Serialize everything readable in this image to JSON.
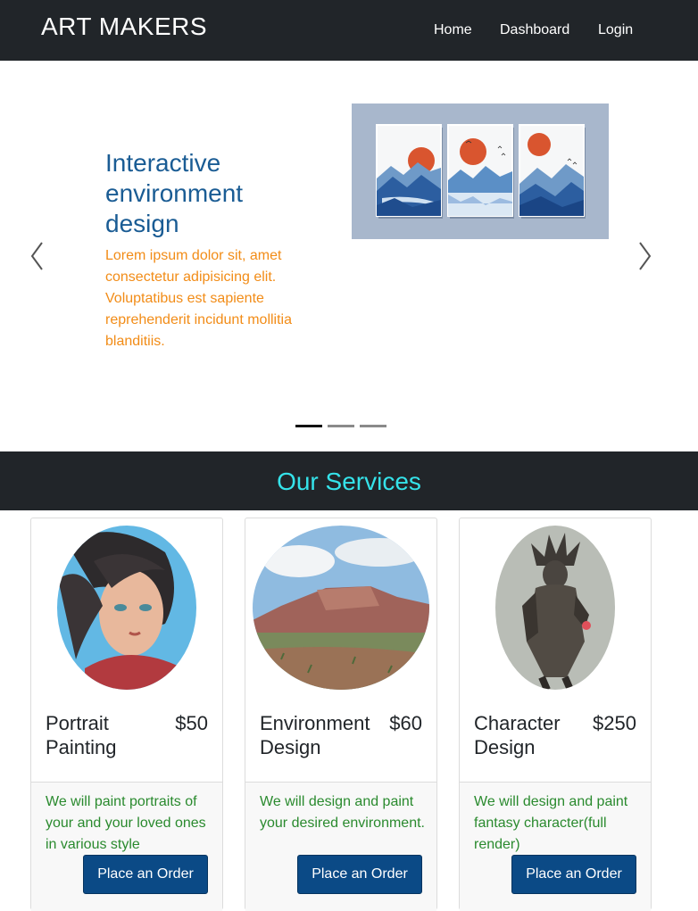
{
  "navbar": {
    "brand": "ART MAKERS",
    "links": [
      "Home",
      "Dashboard",
      "Login"
    ]
  },
  "carousel": {
    "title": "Interactive environment design",
    "text": "Lorem ipsum dolor sit, amet consectetur adipisicing elit. Voluptatibus est sapiente reprehenderit incidunt mollitia blanditiis.",
    "prev_icon": "chevron-left-icon",
    "next_icon": "chevron-right-icon",
    "slide_count": 3,
    "active_slide": 1
  },
  "services": {
    "title": "Our Services",
    "cards": [
      {
        "name": "Portrait Painting",
        "price": "$50",
        "description": "We will paint portraits of your and your loved ones in various style",
        "button": "Place an Order"
      },
      {
        "name": "Environment Design",
        "price": "$60",
        "description": "We will design and paint your desired environment.",
        "button": "Place an Order"
      },
      {
        "name": "Character Design",
        "price": "$250",
        "description": "We will design and paint fantasy character(full render)",
        "button": "Place an Order"
      }
    ]
  },
  "colors": {
    "navbar": "#212529",
    "title_blue": "#1a5c94",
    "text_orange": "#f28c17",
    "services_title": "#35e3ea",
    "description_green": "#2a8a2e",
    "button_blue": "#0b4a86"
  }
}
